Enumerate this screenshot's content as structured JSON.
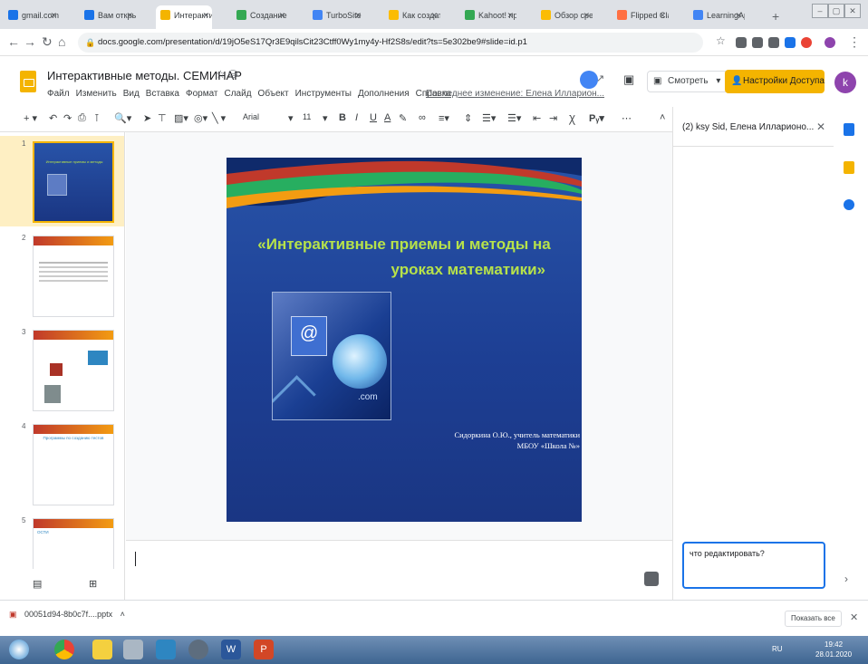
{
  "browser": {
    "tabs": [
      {
        "label": "gmail.com",
        "color": "#1a73e8"
      },
      {
        "label": "Вам открыт д",
        "color": "#1a73e8"
      },
      {
        "label": "Интерактив",
        "color": "#f4b400",
        "active": true
      },
      {
        "label": "Создание те",
        "color": "#34a853"
      },
      {
        "label": "TurboSite",
        "color": "#4285f4"
      },
      {
        "label": "Как создать",
        "color": "#fbbc04"
      },
      {
        "label": "Kahoot! прои",
        "color": "#34a853"
      },
      {
        "label": "Обзор средс",
        "color": "#fbbc04"
      },
      {
        "label": "Flipped Class",
        "color": "#ff7043"
      },
      {
        "label": "LearningApp",
        "color": "#4285f4"
      }
    ],
    "new_tab": "+",
    "url": "docs.google.com/presentation/d/19jO5eS17Qr3E9qilsCit23Ctff0Wy1my4y-Hf2S8s/edit?ts=5e302be9#slide=id.p1"
  },
  "docs": {
    "title": "Интерактивные методы. СЕМИНАР",
    "menu": [
      "Файл",
      "Изменить",
      "Вид",
      "Вставка",
      "Формат",
      "Слайд",
      "Объект",
      "Инструменты",
      "Дополнения",
      "Справка"
    ],
    "last_edit": "Последнее изменение: Елена Илларион...",
    "present_label": "Смотреть",
    "share_label": "Настройки Доступа",
    "avatar_letter": "k",
    "toolbar": {
      "font": "Arial",
      "font_size": "11"
    }
  },
  "filmstrip": {
    "slides": [
      {
        "num": "1",
        "caption": "Интерактивные приемы и методы"
      },
      {
        "num": "2",
        "caption": ""
      },
      {
        "num": "3",
        "caption": ""
      },
      {
        "num": "4",
        "caption": "Программы по созданию тестов"
      },
      {
        "num": "5",
        "caption": "ОСТИ"
      }
    ]
  },
  "slide": {
    "title_line1": "«Интерактивные приемы и методы на",
    "title_line2": "уроках математики»",
    "author_line1": "Сидоркина О.Ю., учитель математики",
    "author_line2": "МБОУ «Школа №»"
  },
  "chat": {
    "title": "(2) ksy Sid, Елена Илларионо...",
    "input_value": "что редактировать?"
  },
  "download": {
    "filename": "00051d94-8b0c7f....pptx",
    "show_all": "Показать все"
  },
  "taskbar": {
    "time": "19:42",
    "date": "28.01.2020",
    "lang": "RU"
  },
  "colors": {
    "slides_yellow": "#f4b400",
    "slide_blue": "#1d3f94",
    "title_green": "#b7e24a",
    "chat_focus": "#1a73e8"
  }
}
